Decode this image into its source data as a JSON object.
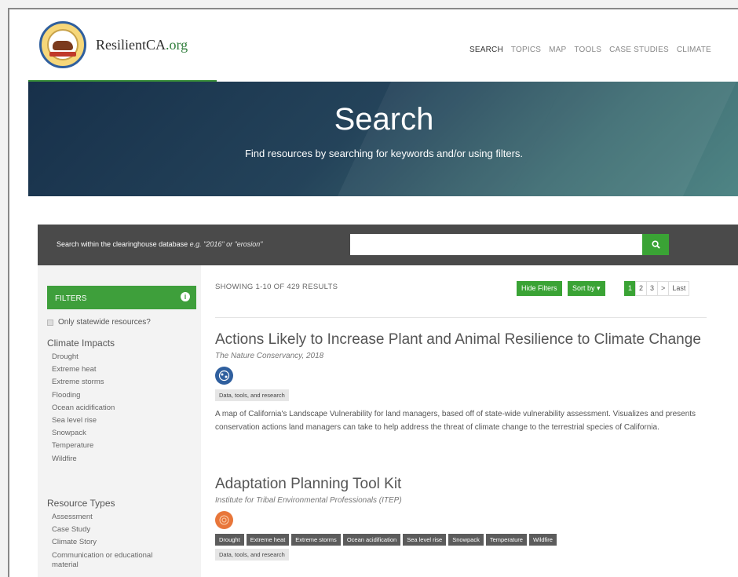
{
  "header": {
    "site_name_main": "ResilientCA",
    "site_name_suffix": ".org",
    "nav": [
      "SEARCH",
      "TOPICS",
      "MAP",
      "TOOLS",
      "CASE STUDIES",
      "CLIMATE"
    ]
  },
  "hero": {
    "title": "Search",
    "subtitle": "Find resources by searching for keywords and/or using filters."
  },
  "search": {
    "label": "Search within the clearinghouse database",
    "example": "e.g. \"2016\" or \"erosion\"",
    "value": "",
    "button_icon": "search-icon"
  },
  "filters": {
    "heading": "FILTERS",
    "info_icon": "i",
    "statewide_label": "Only statewide resources?",
    "climate_impacts_title": "Climate Impacts",
    "climate_impacts": [
      "Drought",
      "Extreme heat",
      "Extreme storms",
      "Flooding",
      "Ocean acidification",
      "Sea level rise",
      "Snowpack",
      "Temperature",
      "Wildfire"
    ],
    "resource_types_title": "Resource Types",
    "resource_types": [
      "Assessment",
      "Case Study",
      "Climate Story",
      "Communication or educational material"
    ]
  },
  "results_bar": {
    "showing": "SHOWING 1-10 OF 429 RESULTS",
    "hide_filters": "Hide Filters",
    "sort_by": "Sort by ▾",
    "pages": [
      "1",
      "2",
      "3",
      ">",
      "Last"
    ],
    "active_page": "1"
  },
  "results": [
    {
      "title": "Actions Likely to Increase Plant and Animal Resilience to Climate Change",
      "org": "The Nature Conservancy, 2018",
      "icon_color": "#2f5f9e",
      "tags": [
        "Data, tools, and research"
      ],
      "description": "A map of California's Landscape Vulnerability for land managers, based off of state-wide vulnerability assessment. Visualizes and presents conservation actions land managers can take to help address the threat of climate change to the terrestrial species of California."
    },
    {
      "title": "Adaptation Planning Tool Kit",
      "org": "Institute for Tribal Environmental Professionals (ITEP)",
      "icon_color": "#e8763a",
      "tags": [
        "Drought",
        "Extreme heat",
        "Extreme storms",
        "Ocean acidification",
        "Sea level rise",
        "Snowpack",
        "Temperature",
        "Wildfire"
      ],
      "tags2": [
        "Data, tools, and research"
      ]
    }
  ]
}
